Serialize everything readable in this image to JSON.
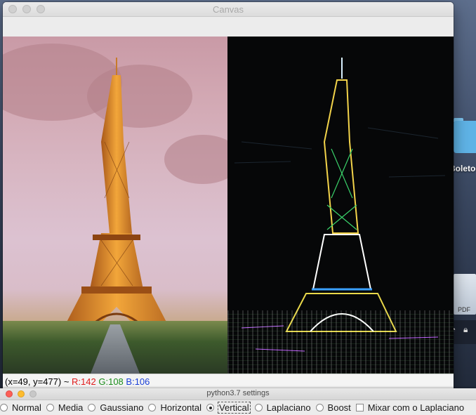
{
  "canvas_window": {
    "title": "Canvas"
  },
  "status": {
    "coords": "(x=49, y=477) ~",
    "r": "R:142",
    "g": "G:108",
    "b": "B:106"
  },
  "settings_window": {
    "title": "python3.7 settings",
    "options": [
      {
        "label": "Normal",
        "type": "radio",
        "checked": false
      },
      {
        "label": "Media",
        "type": "radio",
        "checked": false
      },
      {
        "label": "Gaussiano",
        "type": "radio",
        "checked": false
      },
      {
        "label": "Horizontal",
        "type": "radio",
        "checked": false
      },
      {
        "label": "Vertical",
        "type": "radio",
        "checked": true
      },
      {
        "label": "Laplaciano",
        "type": "radio",
        "checked": false
      },
      {
        "label": "Boost",
        "type": "radio",
        "checked": false
      },
      {
        "label": "Mixar com o Laplaciano",
        "type": "checkbox",
        "checked": false
      }
    ]
  },
  "desktop": {
    "folder_label": "Boleto",
    "pdf_label": "PDF"
  },
  "colors": {
    "status_r": "#e01b1b",
    "status_g": "#1a8c1a",
    "status_b": "#1a3fd6"
  }
}
